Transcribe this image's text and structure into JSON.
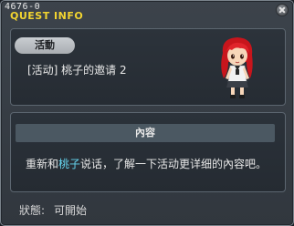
{
  "window": {
    "quest_id": "4676-0",
    "title": "QUEST INFO"
  },
  "quest": {
    "category_tag": "活動",
    "name": "[活动] 桃子的邀请 2"
  },
  "details": {
    "section_title": "內容",
    "description_prefix": "重新和",
    "description_highlight": "桃子",
    "description_suffix": "说话，了解一下活动更详细的內容吧。"
  },
  "status": {
    "label": "狀態:",
    "value": "可開始"
  },
  "colors": {
    "title": "#f2d430",
    "highlight": "#66d6f0"
  },
  "icons": {
    "close": "close-icon",
    "npc": "npc-portrait"
  }
}
